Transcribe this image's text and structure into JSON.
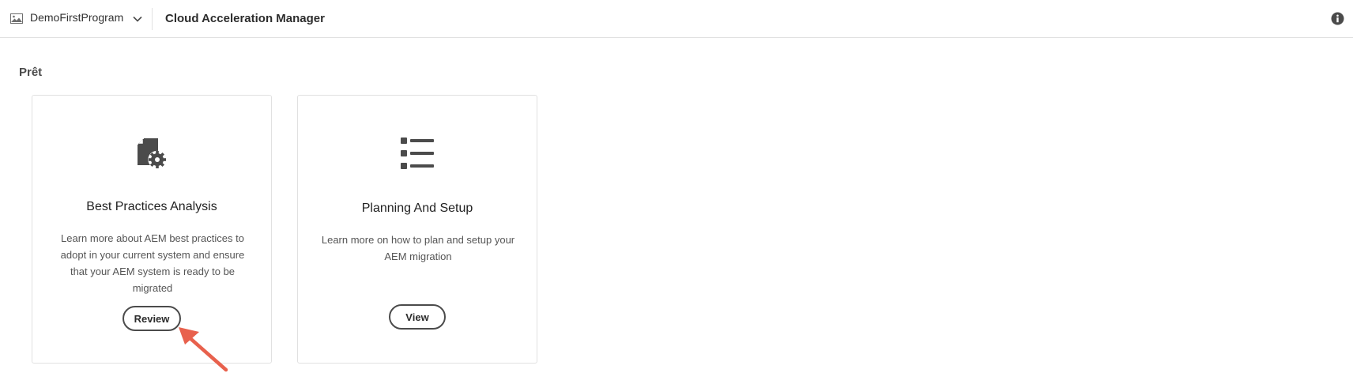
{
  "header": {
    "program_name": "DemoFirstProgram",
    "app_title": "Cloud Acceleration Manager",
    "program_icon": "image-icon",
    "dropdown_icon": "chevron-down-icon",
    "info_icon": "info-icon"
  },
  "section": {
    "heading": "Prêt"
  },
  "cards": [
    {
      "icon": "document-gear-icon",
      "title": "Best Practices Analysis",
      "description": "Learn more about AEM best practices to adopt in your current system and ensure that your AEM system is ready to be migrated",
      "button_label": "Review"
    },
    {
      "icon": "list-icon",
      "title": "Planning And Setup",
      "description": "Learn more on how to plan and setup your AEM migration",
      "button_label": "View"
    }
  ],
  "annotation": {
    "arrow_color": "#e8614d"
  },
  "colors": {
    "icon_gray": "#4b4b4b",
    "border": "#e1e1e1"
  }
}
